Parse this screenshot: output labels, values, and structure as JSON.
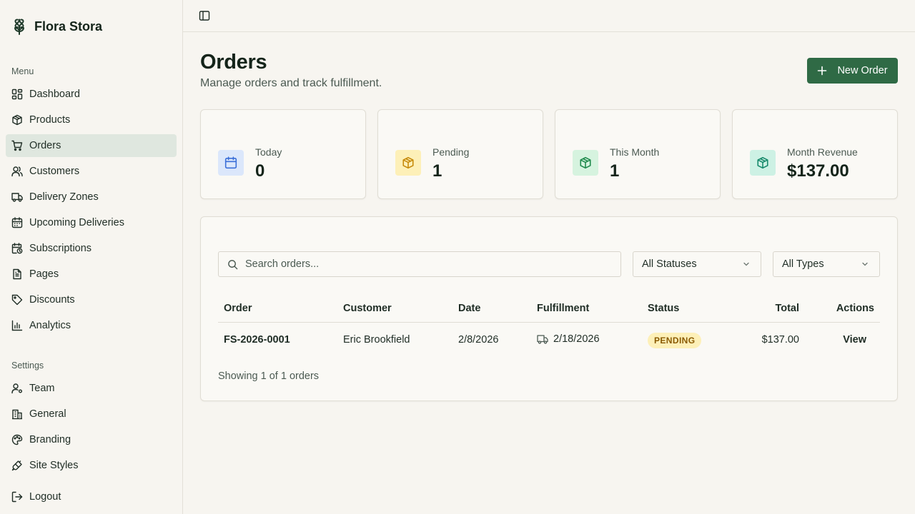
{
  "brand": {
    "name": "Flora Stora"
  },
  "sidebar": {
    "menu_label": "Menu",
    "menu_items": [
      {
        "label": "Dashboard",
        "icon": "dashboard-icon"
      },
      {
        "label": "Products",
        "icon": "package-icon"
      },
      {
        "label": "Orders",
        "icon": "cart-icon",
        "active": true
      },
      {
        "label": "Customers",
        "icon": "users-icon"
      },
      {
        "label": "Delivery Zones",
        "icon": "truck-icon"
      },
      {
        "label": "Upcoming Deliveries",
        "icon": "calendar-icon"
      },
      {
        "label": "Subscriptions",
        "icon": "calendar-clock-icon"
      },
      {
        "label": "Pages",
        "icon": "file-icon"
      },
      {
        "label": "Discounts",
        "icon": "tag-icon"
      },
      {
        "label": "Analytics",
        "icon": "chart-icon"
      }
    ],
    "settings_label": "Settings",
    "settings_items": [
      {
        "label": "Team",
        "icon": "user-cog-icon"
      },
      {
        "label": "General",
        "icon": "building-icon"
      },
      {
        "label": "Branding",
        "icon": "palette-icon"
      },
      {
        "label": "Site Styles",
        "icon": "brush-icon"
      }
    ],
    "logout_label": "Logout"
  },
  "header": {
    "title": "Orders",
    "subtitle": "Manage orders and track fulfillment.",
    "new_order_label": "New Order"
  },
  "stats": [
    {
      "label": "Today",
      "value": "0",
      "icon": "calendar-icon",
      "color": "#3b6fd8",
      "bg": "#dbe7fb"
    },
    {
      "label": "Pending",
      "value": "1",
      "icon": "package-icon",
      "color": "#c68a0a",
      "bg": "#fdf0b8"
    },
    {
      "label": "This Month",
      "value": "1",
      "icon": "package-icon",
      "color": "#1f8a4c",
      "bg": "#d6f3df"
    },
    {
      "label": "Month Revenue",
      "value": "$137.00",
      "icon": "package-icon",
      "color": "#16896a",
      "bg": "#cdf1e4"
    }
  ],
  "filters": {
    "search_placeholder": "Search orders...",
    "status_value": "All Statuses",
    "type_value": "All Types"
  },
  "table": {
    "columns": [
      "Order",
      "Customer",
      "Date",
      "Fulfillment",
      "Status",
      "Total",
      "Actions"
    ],
    "rows": [
      {
        "order": "FS-2026-0001",
        "customer": "Eric Brookfield",
        "date": "2/8/2026",
        "fulfillment": "2/18/2026",
        "status": "PENDING",
        "total": "$137.00",
        "action": "View"
      }
    ],
    "footer": "Showing 1 of 1 orders"
  },
  "colors": {
    "accent": "#2f6a45",
    "active_nav_bg": "#dfe7df",
    "background": "#f7f5f0"
  }
}
